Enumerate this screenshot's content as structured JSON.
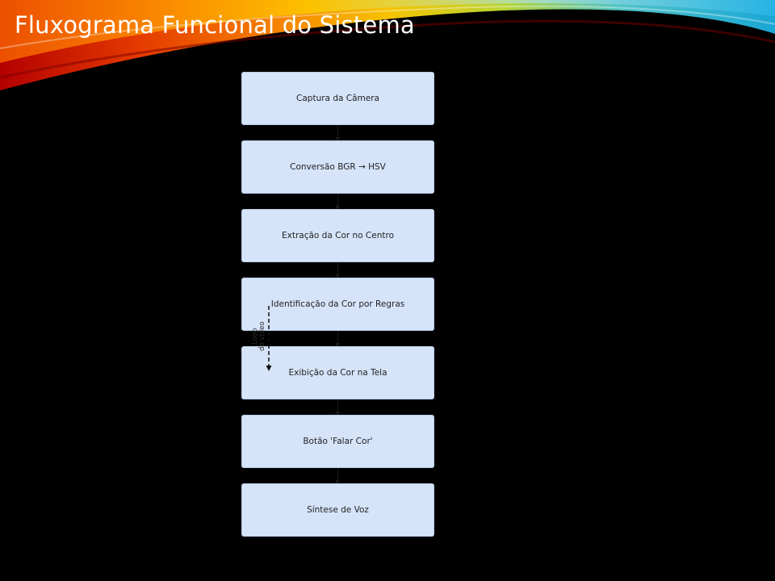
{
  "slide": {
    "title": "Fluxograma Funcional do Sistema",
    "background_color": "#000000"
  },
  "diagram": {
    "box_fill": "#d6e4fa",
    "steps": [
      {
        "label": "Captura da Câmera"
      },
      {
        "label": "Conversão BGR → HSV"
      },
      {
        "label": "Extração da Cor no Centro"
      },
      {
        "label": "Identificação da Cor por Regras"
      },
      {
        "label": "Exibição da Cor na Tela"
      },
      {
        "label": "Botão 'Falar Cor'"
      },
      {
        "label": "Síntese de Voz"
      }
    ],
    "loop": {
      "label": "Loop\ndo vídeo"
    }
  }
}
